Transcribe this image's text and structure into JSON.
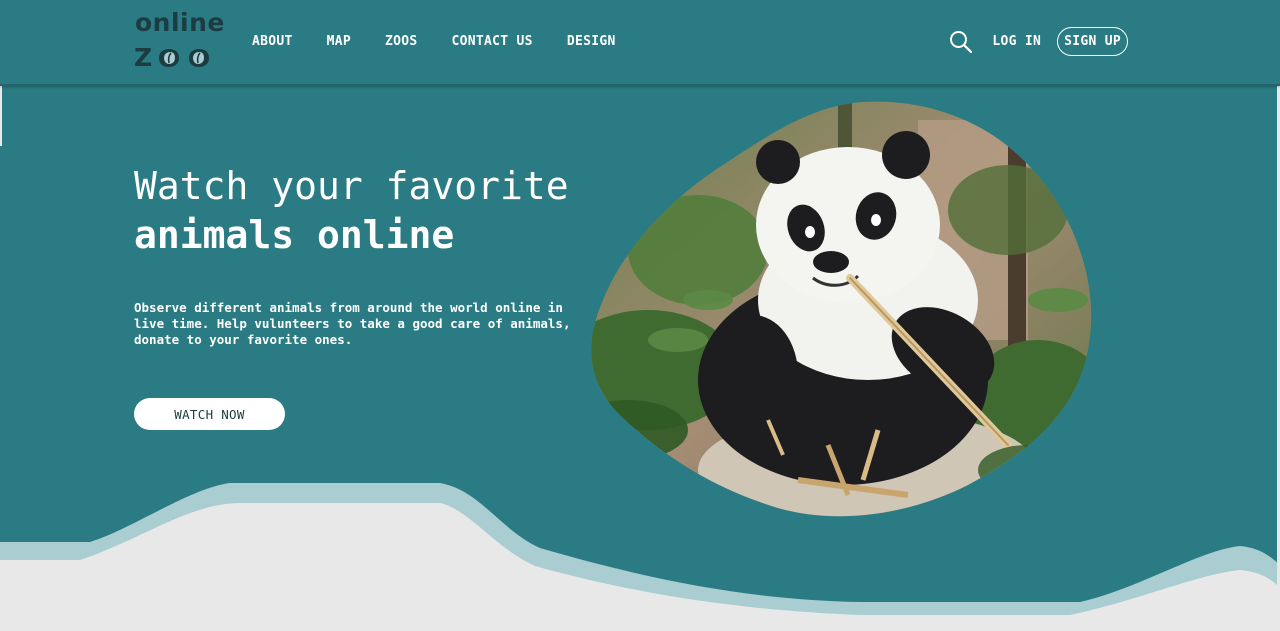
{
  "brand": {
    "logo_top": "online",
    "logo_bottom_letter": "Z",
    "icon": "eye-leaf-icon"
  },
  "nav": {
    "items": [
      {
        "label": "ABOUT"
      },
      {
        "label": "MAP"
      },
      {
        "label": "ZOOS"
      },
      {
        "label": "CONTACT US"
      },
      {
        "label": "DESIGN"
      }
    ]
  },
  "header_actions": {
    "search_icon": "search-icon",
    "login_label": "LOG IN",
    "signup_label": "SIGN UP"
  },
  "hero": {
    "title_line1": "Watch your favorite",
    "title_line2": "animals online",
    "description": "Observe different animals from around the world online in live time. Help vulunteers to take a good care of animals, donate to your favorite ones.",
    "cta_label": "WATCH NOW",
    "image_subject": "panda-eating-bamboo"
  },
  "colors": {
    "background": "#2a7b83",
    "logo": "#1c3c42",
    "wave_light": "#a9cdd1",
    "wave_base": "#e8e8e8",
    "button_bg": "#ffffff"
  }
}
